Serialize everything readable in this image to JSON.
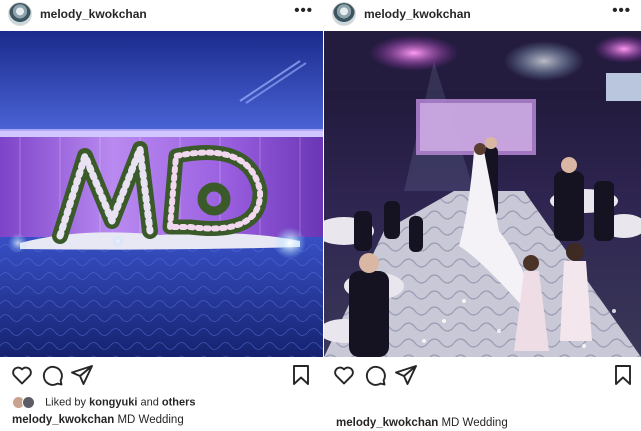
{
  "posts": [
    {
      "username": "melody_kwokchan",
      "more": "•••",
      "likes": {
        "prefix": "Liked by",
        "user": "kongyuki",
        "joiner": "and",
        "others": "others"
      },
      "caption": {
        "user": "melody_kwokchan",
        "text": "MD Wedding"
      },
      "icons": [
        "heart-icon",
        "comment-icon",
        "share-icon",
        "bookmark-icon"
      ]
    },
    {
      "username": "melody_kwokchan",
      "more": "•••",
      "caption": {
        "user": "melody_kwokchan",
        "text": "MD Wedding"
      },
      "icons": [
        "heart-icon",
        "comment-icon",
        "share-icon",
        "bookmark-icon"
      ]
    }
  ],
  "colors": {
    "text": "#262626",
    "background": "#ffffff",
    "stage_purple": "#8a4fd8",
    "floor_blue": "#2b3fa8"
  }
}
